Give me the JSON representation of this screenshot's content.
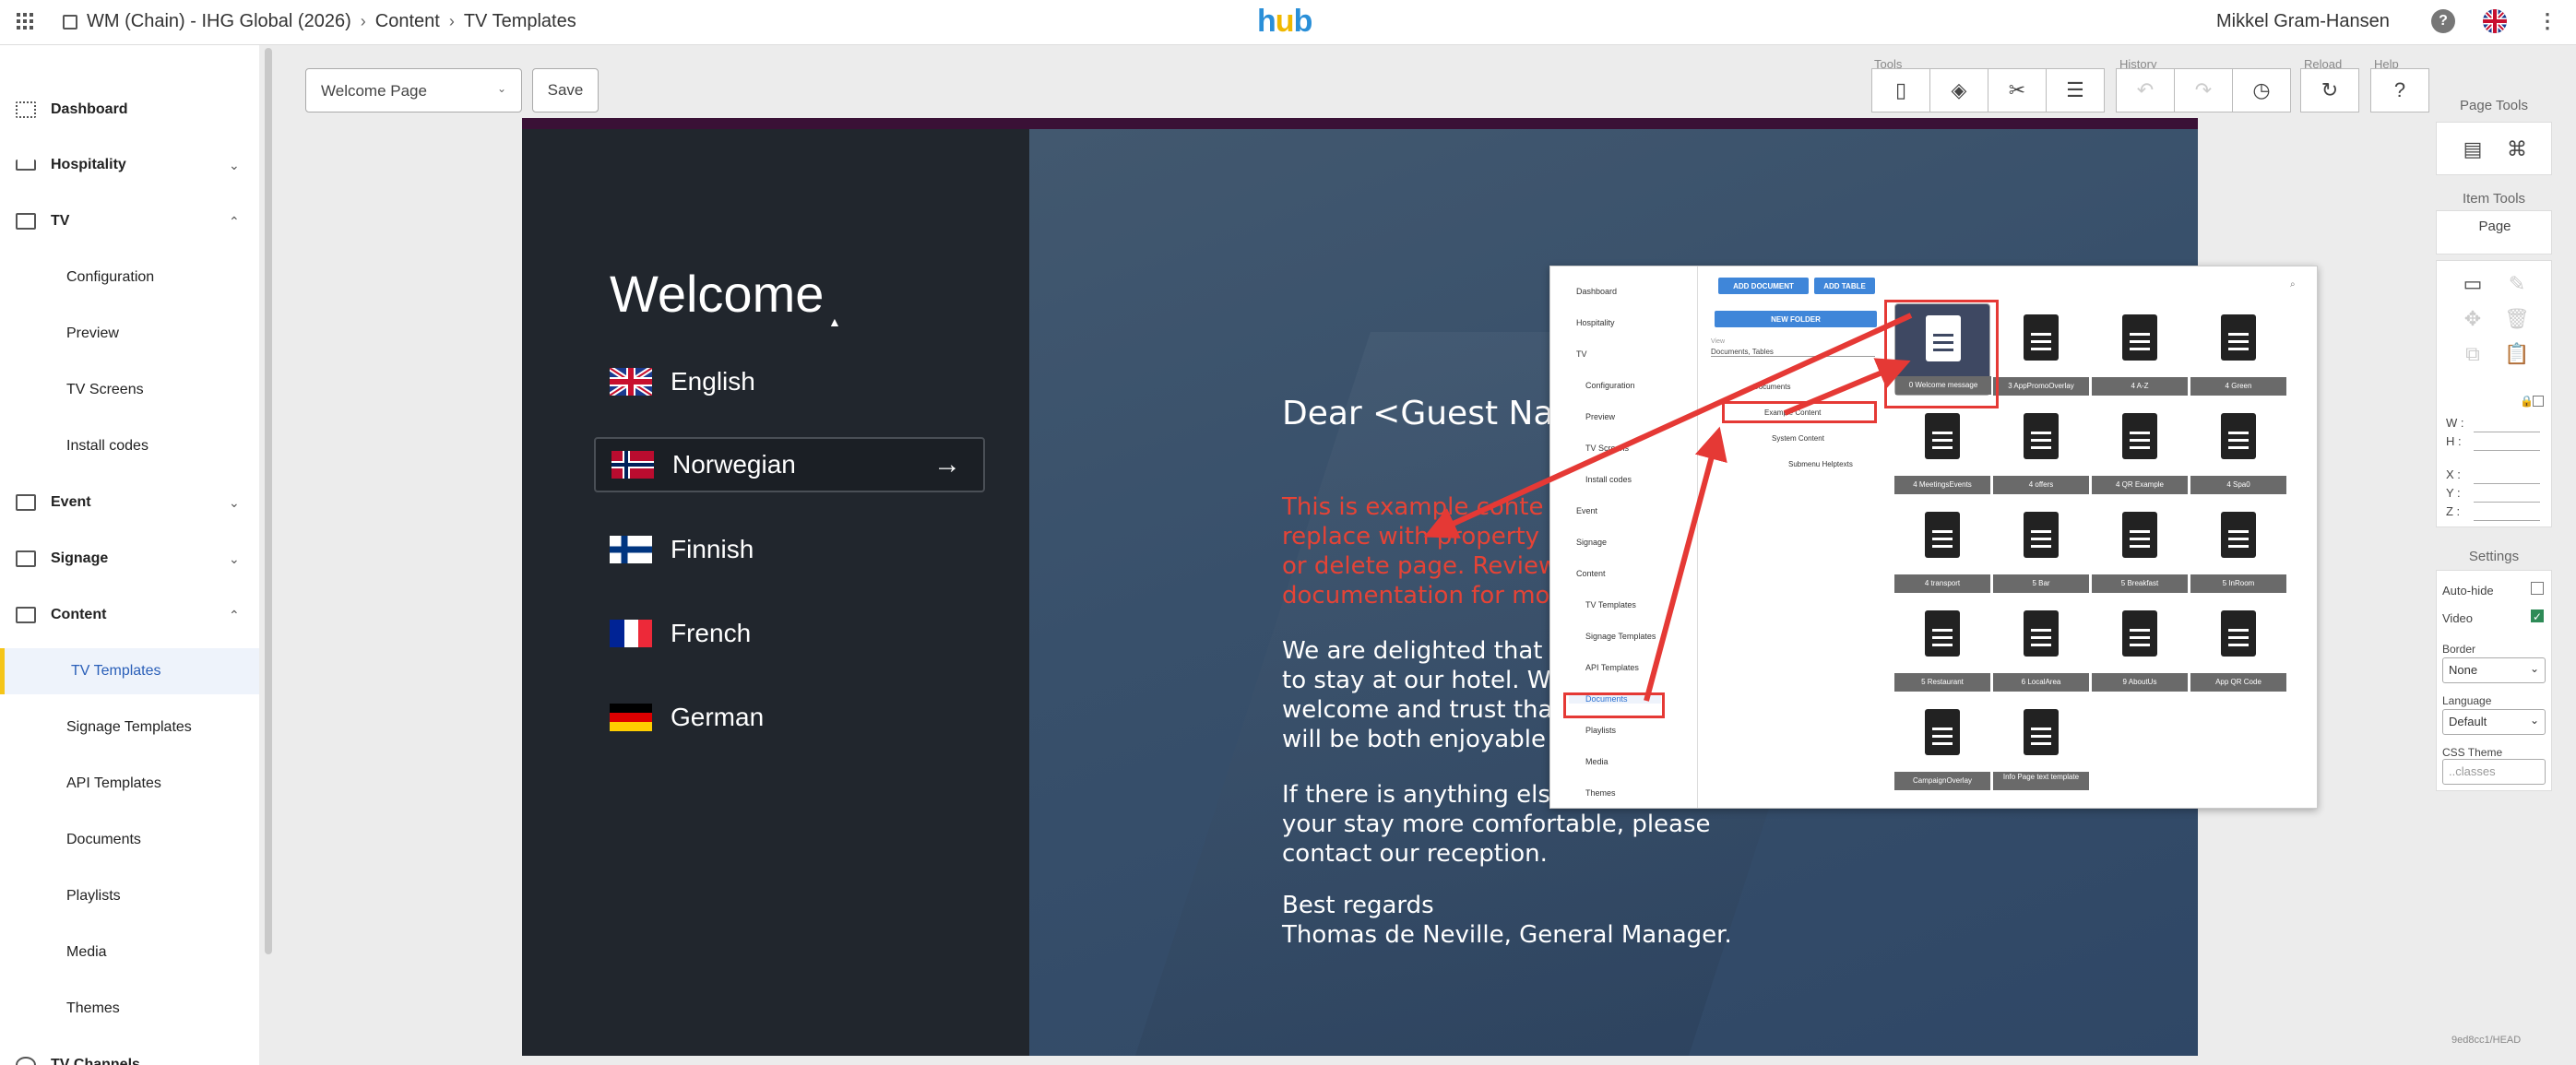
{
  "topbar": {
    "breadcrumb": [
      "WM (Chain) - IHG Global (2026)",
      "Content",
      "TV Templates"
    ],
    "logo": {
      "h": "h",
      "u": "u",
      "b": "b"
    },
    "user": "Mikkel Gram-Hansen",
    "icons": [
      "help-icon",
      "uk-flag-icon",
      "more-icon"
    ]
  },
  "sidebar": {
    "items": [
      {
        "label": "Dashboard",
        "icon": "dashboard-icon"
      },
      {
        "label": "Hospitality",
        "icon": "bed-icon",
        "chevron": "⌄"
      },
      {
        "label": "TV",
        "icon": "tv-icon",
        "chevron": "⌃"
      },
      {
        "label": "Event",
        "icon": "calendar-icon",
        "chevron": "⌄"
      },
      {
        "label": "Signage",
        "icon": "signage-icon",
        "chevron": "⌄"
      },
      {
        "label": "Content",
        "icon": "content-icon",
        "chevron": "⌃"
      },
      {
        "label": "TV Channels",
        "icon": "broadcast-icon",
        "chevron": "⌄"
      }
    ],
    "tv_subitems": [
      "Configuration",
      "Preview",
      "TV Screens",
      "Install codes"
    ],
    "content_subitems": [
      "TV Templates",
      "Signage Templates",
      "API Templates",
      "Documents",
      "Playlists",
      "Media",
      "Themes"
    ]
  },
  "editor": {
    "page_select": "Welcome Page",
    "save_label": "Save",
    "groups": {
      "tools": "Tools",
      "history": "History",
      "reload": "Reload",
      "help": "Help"
    }
  },
  "right_panel": {
    "page_tools_title": "Page Tools",
    "item_tools_title": "Item Tools",
    "item_tools_target": "Page",
    "fields": {
      "w": "W :",
      "h": "H :",
      "x": "X :",
      "y": "Y :",
      "z": "Z :"
    },
    "settings_title": "Settings",
    "auto_hide": "Auto-hide",
    "video": "Video",
    "border_label": "Border",
    "border_value": "None",
    "language_label": "Language",
    "language_value": "Default",
    "css_theme_label": "CSS Theme",
    "css_theme_placeholder": "..classes"
  },
  "footer": "9ed8cc1/HEAD",
  "preview": {
    "welcome": "Welcome",
    "languages": [
      "English",
      "Norwegian",
      "Finnish",
      "French",
      "German"
    ],
    "selected_language": "Norwegian",
    "arrow": "→",
    "dear": "Dear <Guest Na",
    "red_lines": [
      "This is example conte",
      "replace with property",
      "or delete page. Review",
      "documentation for mo"
    ],
    "body1_lines": [
      "We are delighted that",
      "to stay at our hotel. W",
      "welcome and trust tha",
      "will be both enjoyable"
    ],
    "body2_lines": [
      "If there is anything els",
      "your stay more comfortable, please",
      "contact our reception."
    ],
    "signoff": [
      "Best regards",
      "Thomas de Neville, General Manager."
    ]
  },
  "overlay": {
    "nav": [
      "Dashboard",
      "Hospitality",
      "TV",
      "Event",
      "Signage",
      "Content"
    ],
    "tv_sub": [
      "Configuration",
      "Preview",
      "TV Screens",
      "Install codes"
    ],
    "content_sub": [
      "TV Templates",
      "Signage Templates",
      "API Templates",
      "Documents",
      "Playlists",
      "Media",
      "Themes"
    ],
    "add_document": "ADD DOCUMENT",
    "add_table": "ADD TABLE",
    "new_folder": "NEW FOLDER",
    "view_label": "View",
    "view_value": "Documents, Tables",
    "tree": [
      "Documents",
      "Example Content",
      "System Content",
      "Submenu Helptexts"
    ],
    "docs": [
      "0 Welcome message",
      "3 AppPromoOverlay",
      "4 A-Z",
      "4 Green",
      "4 MeetingsEvents",
      "4 offers",
      "4 QR Example",
      "4 Spa0",
      "4 transport",
      "5 Bar",
      "5 Breakfast",
      "5 InRoom",
      "5 Restaurant",
      "6 LocalArea",
      "9 AboutUs",
      "App QR Code",
      "CampaignOverlay",
      "Info Page text template"
    ]
  }
}
